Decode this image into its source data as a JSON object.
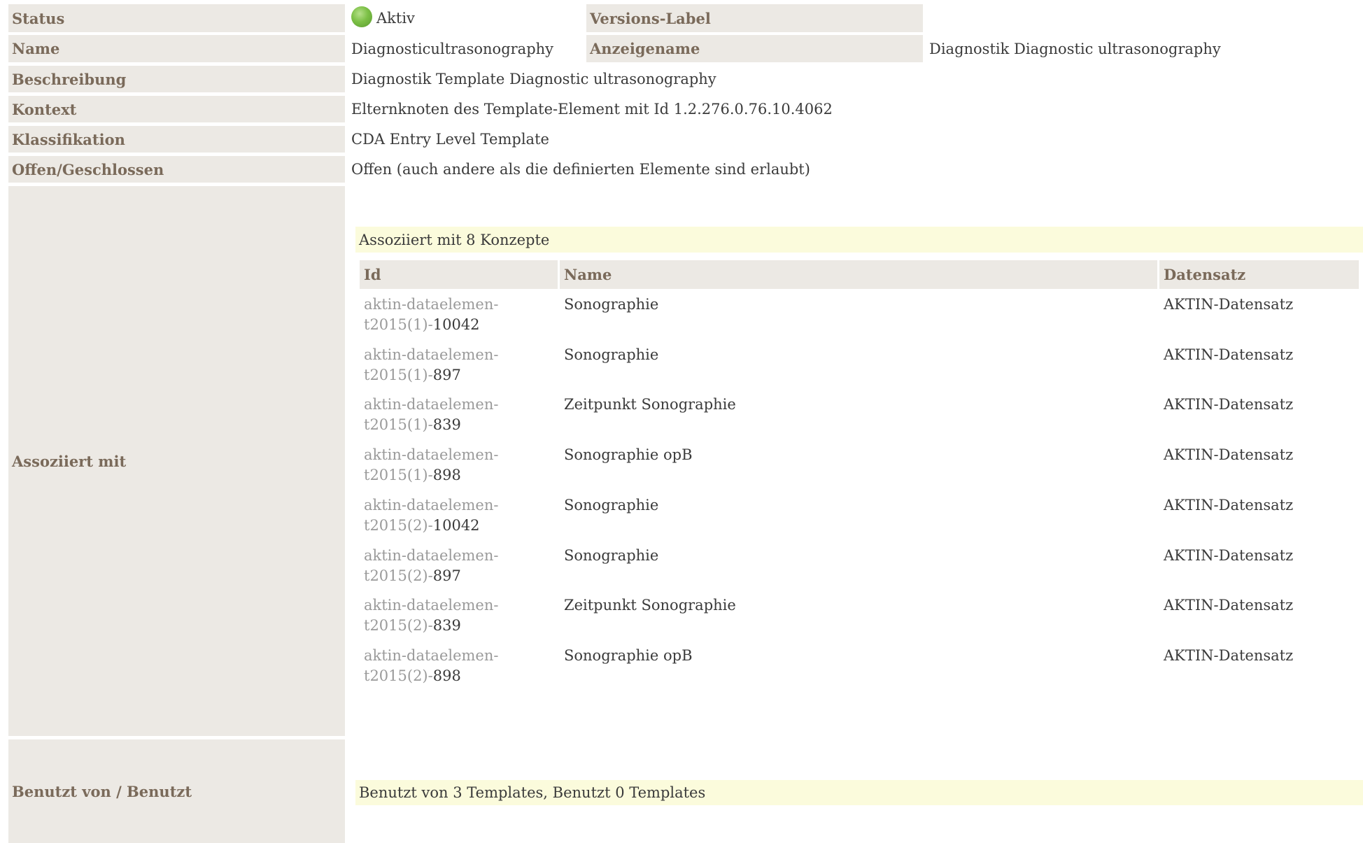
{
  "rows": {
    "status": {
      "label": "Status",
      "value": "Aktiv",
      "status_color": "#7cc046"
    },
    "versions_label": {
      "label": "Versions-Label",
      "value": ""
    },
    "name": {
      "label": "Name",
      "value": "Diagnosticultrasonography"
    },
    "anzeigename": {
      "label": "Anzeigename",
      "value": "Diagnostik Diagnostic ultrasonography"
    },
    "beschreibung": {
      "label": "Beschreibung",
      "value": "Diagnostik Template Diagnostic ultrasonography"
    },
    "kontext": {
      "label": "Kontext",
      "value": "Elternknoten des Template-Element mit Id 1.2.276.0.76.10.4062"
    },
    "klassifikation": {
      "label": "Klassifikation",
      "value": "CDA Entry Level Template"
    },
    "offen": {
      "label": "Offen/Geschlossen",
      "value": "Offen (auch andere als die definierten Elemente sind erlaubt)"
    },
    "assoziiert": {
      "label": "Assoziiert mit"
    },
    "benutzt": {
      "label": "Benutzt von / Benutzt"
    }
  },
  "associations": {
    "summary": "Assoziiert mit 8 Konzepte",
    "headers": {
      "id": "Id",
      "name": "Name",
      "dataset": "Datensatz"
    },
    "items": [
      {
        "id_line1": "aktin-dataelemen-",
        "id_prefix": "t2015(1)-",
        "id_num": "10042",
        "name": "Sonographie",
        "dataset": "AKTIN-Datensatz"
      },
      {
        "id_line1": "aktin-dataelemen-",
        "id_prefix": "t2015(1)-",
        "id_num": "897",
        "name": "Sonographie",
        "dataset": "AKTIN-Datensatz"
      },
      {
        "id_line1": "aktin-dataelemen-",
        "id_prefix": "t2015(1)-",
        "id_num": "839",
        "name": "Zeitpunkt Sonographie",
        "dataset": "AKTIN-Datensatz"
      },
      {
        "id_line1": "aktin-dataelemen-",
        "id_prefix": "t2015(1)-",
        "id_num": "898",
        "name": "Sonographie opB",
        "dataset": "AKTIN-Datensatz"
      },
      {
        "id_line1": "aktin-dataelemen-",
        "id_prefix": "t2015(2)-",
        "id_num": "10042",
        "name": "Sonographie",
        "dataset": "AKTIN-Datensatz"
      },
      {
        "id_line1": "aktin-dataelemen-",
        "id_prefix": "t2015(2)-",
        "id_num": "897",
        "name": "Sonographie",
        "dataset": "AKTIN-Datensatz"
      },
      {
        "id_line1": "aktin-dataelemen-",
        "id_prefix": "t2015(2)-",
        "id_num": "839",
        "name": "Zeitpunkt Sonographie",
        "dataset": "AKTIN-Datensatz"
      },
      {
        "id_line1": "aktin-dataelemen-",
        "id_prefix": "t2015(2)-",
        "id_num": "898",
        "name": "Sonographie opB",
        "dataset": "AKTIN-Datensatz"
      }
    ]
  },
  "usage": {
    "summary": "Benutzt von 3 Templates, Benutzt 0 Templates"
  }
}
